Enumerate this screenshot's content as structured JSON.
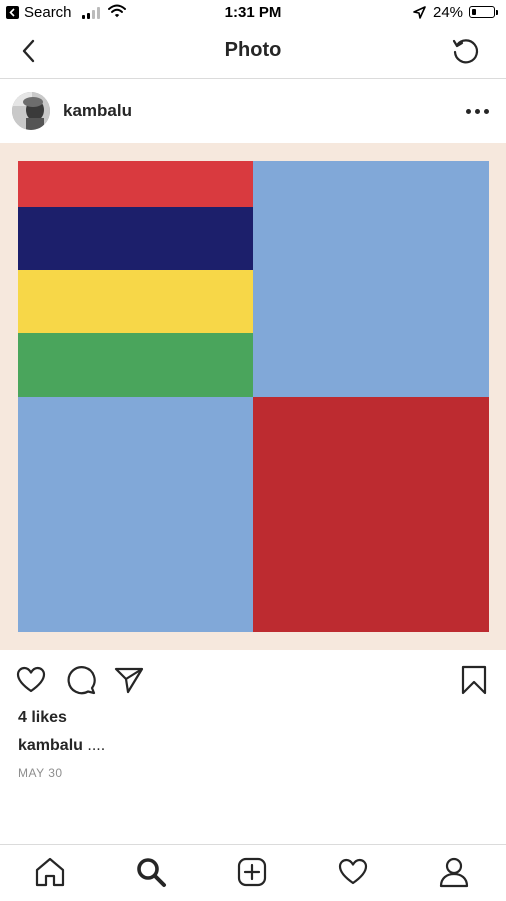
{
  "status_bar": {
    "back_app_label": "Search",
    "time": "1:31 PM",
    "battery_percent": "24%",
    "battery_level": 0.24,
    "icons": [
      "back-to-app-icon",
      "cellular-signal-icon",
      "wifi-icon",
      "location-arrow-icon",
      "battery-icon"
    ]
  },
  "nav": {
    "title": "Photo",
    "back_icon": "chevron-left-icon",
    "refresh_icon": "refresh-icon"
  },
  "post": {
    "username": "kambalu",
    "more_icon": "more-options-icon",
    "image": {
      "background": "#f6e8dd",
      "stripes": [
        "#d93a3f",
        "#1c1f6b",
        "#f7d748",
        "#4aa55c"
      ],
      "top_right": "#81a8d8",
      "bottom_left": "#81a8d8",
      "bottom_right": "#bd2b30"
    },
    "likes": "4 likes",
    "caption_user": "kambalu",
    "caption_text": " ....",
    "date": "MAY 30"
  },
  "actions": {
    "icons": [
      "heart-icon",
      "comment-icon",
      "share-icon",
      "bookmark-icon"
    ]
  },
  "tab_bar": {
    "icons": [
      "home-icon",
      "search-icon",
      "new-post-icon",
      "activity-heart-icon",
      "profile-icon"
    ]
  }
}
